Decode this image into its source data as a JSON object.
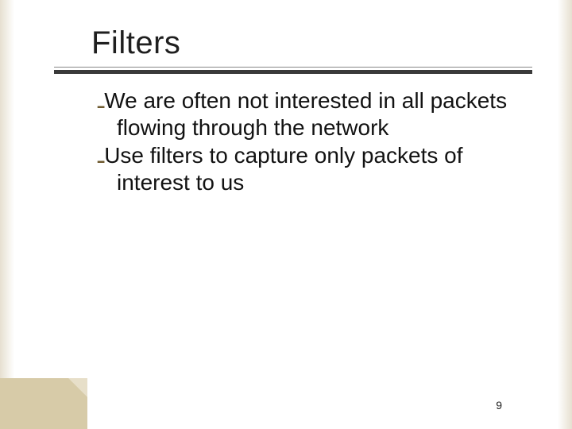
{
  "title": "Filters",
  "bullets": [
    "We are often not interested in all packets flowing through the network",
    "Use filters to capture only packets of interest to us"
  ],
  "bullet_marker": "ـ",
  "page_number": "9"
}
